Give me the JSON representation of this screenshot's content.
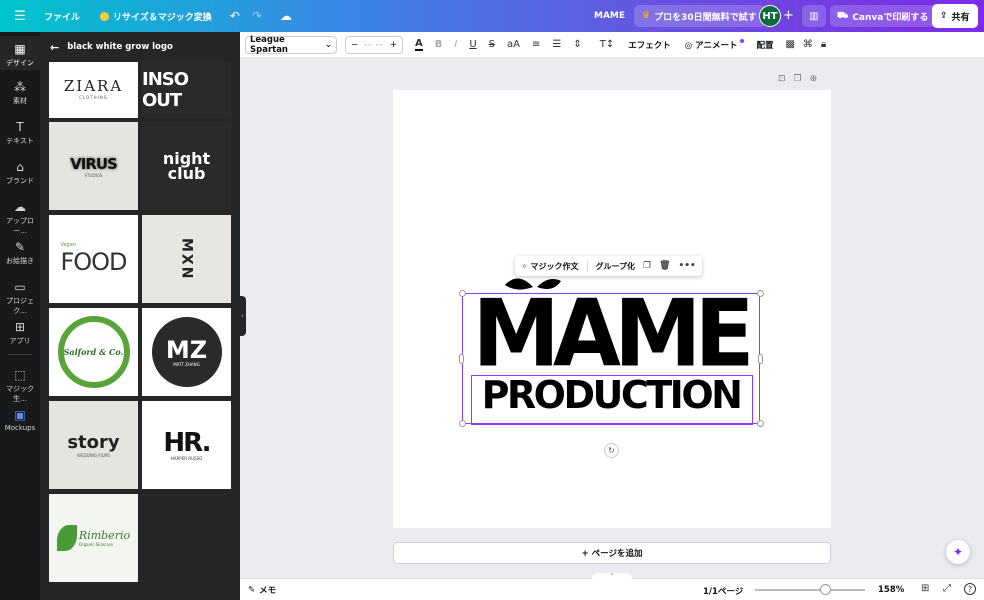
{
  "topbar": {
    "menu_icon": "hamburger-icon",
    "file_label": "ファイル",
    "resize_label": "リサイズ＆マジック変換",
    "doc_title": "MAME",
    "trial_label": "プロを30日間無料で試す",
    "avatar_initials": "HT",
    "print_label": "Canvaで印刷する",
    "share_label": "共有"
  },
  "rail": {
    "items": [
      {
        "label": "デザイン",
        "icon": "design-icon"
      },
      {
        "label": "素材",
        "icon": "elements-icon"
      },
      {
        "label": "テキスト",
        "icon": "text-icon"
      },
      {
        "label": "ブランド",
        "icon": "brand-icon"
      },
      {
        "label": "アップロー...",
        "icon": "upload-icon"
      },
      {
        "label": "お絵描き",
        "icon": "draw-icon"
      },
      {
        "label": "プロジェク...",
        "icon": "projects-icon"
      },
      {
        "label": "アプリ",
        "icon": "apps-icon"
      },
      {
        "label": "マジック生...",
        "icon": "magic-media-icon"
      },
      {
        "label": "Mockups",
        "icon": "mockups-icon"
      }
    ]
  },
  "panel": {
    "search_title": "black white grow logo",
    "tiles": [
      {
        "text": "ZIARA",
        "sub": "CLOTHING"
      },
      {
        "text": "INSO OUT",
        "sub": ""
      },
      {
        "text": "VIRUS",
        "sub": "STUDIOS"
      },
      {
        "text": "night club",
        "sub": ""
      },
      {
        "text": "FOOD",
        "sub": "Vegan"
      },
      {
        "text": "MXN",
        "sub": ""
      },
      {
        "text": "Salford & Co.",
        "sub": ""
      },
      {
        "text": "MZ",
        "sub": "MATT ZHANG"
      },
      {
        "text": "story",
        "sub": "WEDDING FILMS"
      },
      {
        "text": "HR.",
        "sub": "HARPER RUSSO"
      },
      {
        "text": "Rimberio",
        "sub": "Organic Skincare"
      }
    ]
  },
  "toolbar": {
    "font_name": "League Spartan",
    "size_minus": "−",
    "size_value": "-- --",
    "size_plus": "+",
    "effects_label": "エフェクト",
    "animate_label": "アニメート",
    "position_label": "配置"
  },
  "canvas": {
    "logo_line1": "MAME",
    "logo_line2": "PRODUCTION",
    "ctx_magic_write": "マジック作文",
    "ctx_group": "グループ化",
    "add_page_label": "+ ページを追加"
  },
  "bottombar": {
    "notes_label": "メモ",
    "page_indicator": "1/1ページ",
    "zoom_value": "158%",
    "zoom_fraction": 0.64
  },
  "colors": {
    "accent": "#8b3dff",
    "rail_bg": "#18191b",
    "panel_bg": "#252627"
  }
}
